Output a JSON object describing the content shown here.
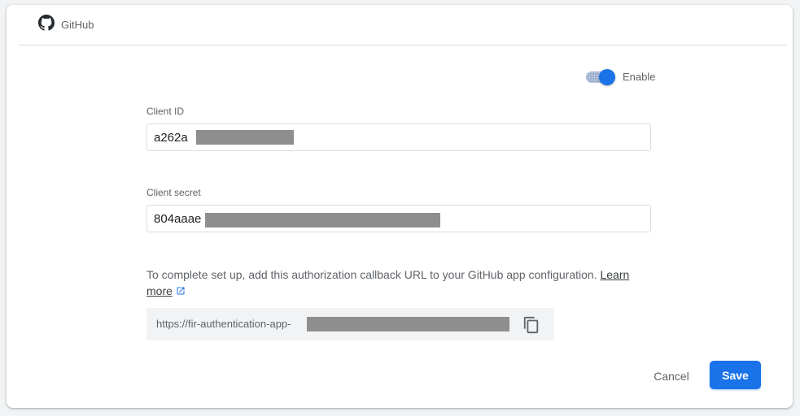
{
  "provider": {
    "name": "GitHub",
    "icon": "github-icon"
  },
  "toggle": {
    "label": "Enable",
    "enabled": true
  },
  "client_id": {
    "label": "Client ID",
    "value": "a262a"
  },
  "client_secret": {
    "label": "Client secret",
    "value": "804aaae"
  },
  "info": {
    "text": "To complete set up, add this authorization callback URL to your GitHub app configuration.",
    "link_learn": "Learn",
    "link_more": "more",
    "link_icon": "external-link-icon"
  },
  "callback": {
    "url": "https://fir-authentication-app-",
    "copy_icon": "copy-icon"
  },
  "actions": {
    "cancel_label": "Cancel",
    "save_label": "Save"
  },
  "colors": {
    "accent": "#1a73e8",
    "redaction": "#8e8e8e",
    "border": "#dadce0"
  }
}
